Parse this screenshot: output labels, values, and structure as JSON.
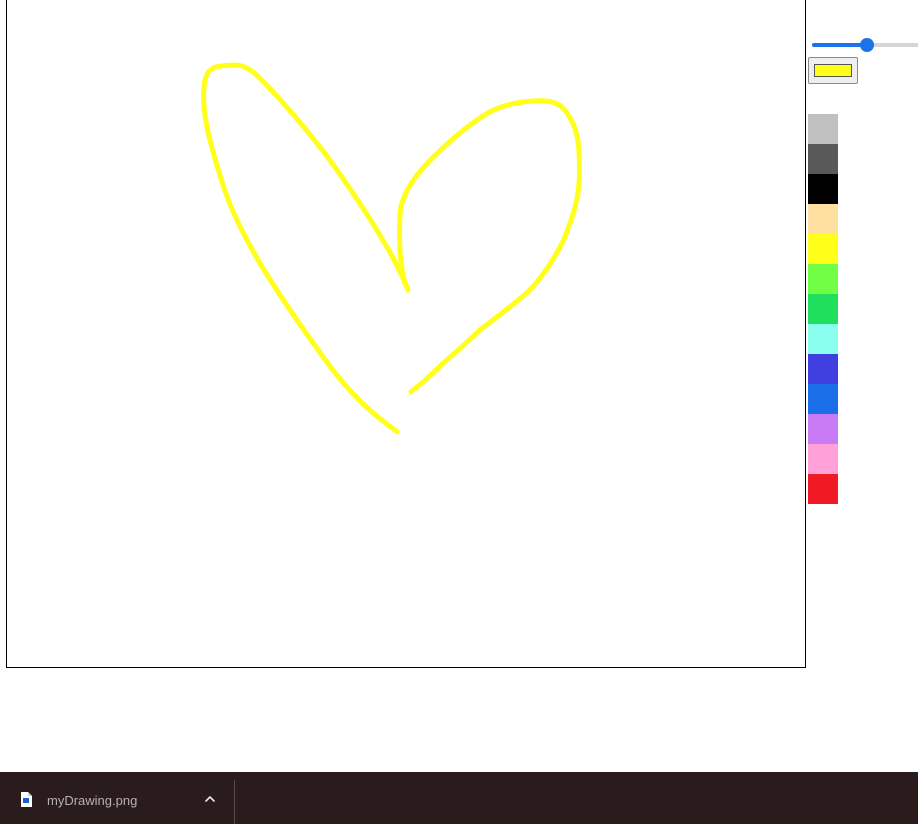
{
  "canvas": {
    "stroke_color": "#ffff1a"
  },
  "toolbar": {
    "brush_size": {
      "value": 50,
      "min": 0,
      "max": 100
    },
    "current_color": "#ffff1a",
    "palette": [
      "#c0c0c0",
      "#595959",
      "#000000",
      "#ffe0a0",
      "#ffff1a",
      "#70ff45",
      "#1fdf5d",
      "#8afff0",
      "#4040e0",
      "#1a6fe8",
      "#c97af5",
      "#ffa0d8",
      "#ef1a24"
    ]
  },
  "download_bar": {
    "file_name": "myDrawing.png",
    "background": "#2a1c1c"
  }
}
